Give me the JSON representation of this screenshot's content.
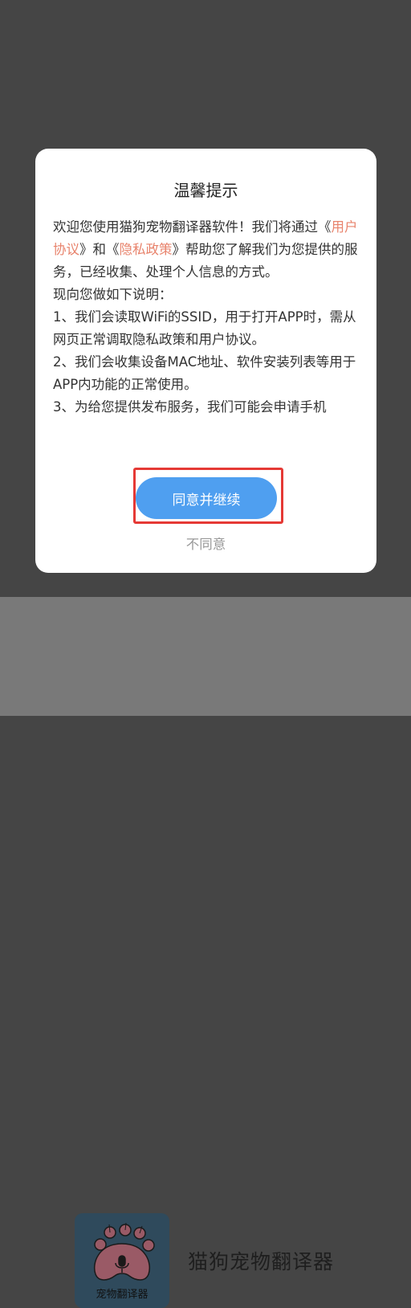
{
  "dialog": {
    "title": "温馨提示",
    "body": {
      "intro_before": "欢迎您使用猫狗宠物翻译器软件！我们将通过《",
      "user_agreement_link": "用户协议",
      "between_links": "》和《",
      "privacy_policy_link": "隐私政策",
      "intro_after": "》帮助您了解我们为您提供的服务，已经收集、处理个人信息的方式。",
      "explain": "现向您做如下说明：",
      "item_1": "1、我们会读取WiFi的SSID，用于打开APP时，需从网页正常调取隐私政策和用户协议。",
      "item_2": "2、我们会收集设备MAC地址、软件安装列表等用于APP内功能的正常使用。",
      "item_3": "3、为给您提供发布服务，我们可能会申请手机"
    },
    "agree_label": "同意并继续",
    "disagree_label": "不同意"
  },
  "app": {
    "name": "猫狗宠物翻译器",
    "icon_text": "宠物翻译器",
    "icon_name": "paw-microphone-icon"
  },
  "colors": {
    "accent": "#4f9ff0",
    "link": "#e8836c",
    "highlight": "#e53935"
  }
}
